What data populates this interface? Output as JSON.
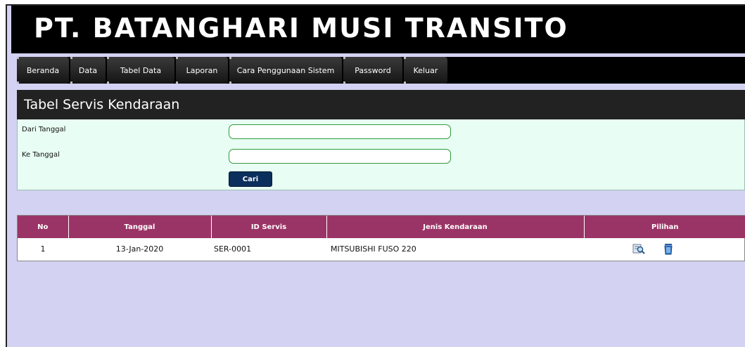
{
  "app": {
    "title": "PT. BATANGHARI MUSI TRANSITO"
  },
  "nav": [
    {
      "label": "Beranda"
    },
    {
      "label": "Data"
    },
    {
      "label": "Tabel Data"
    },
    {
      "label": "Laporan"
    },
    {
      "label": "Cara Penggunaan Sistem"
    },
    {
      "label": "Password"
    },
    {
      "label": "Keluar"
    }
  ],
  "panel": {
    "title": "Tabel Servis Kendaraan"
  },
  "form": {
    "from_label": "Dari Tanggal",
    "from_value": "",
    "to_label": "Ke Tanggal",
    "to_value": "",
    "search_button": "Cari"
  },
  "table": {
    "headers": [
      "No",
      "Tanggal",
      "ID Servis",
      "Jenis Kendaraan",
      "Pilihan"
    ],
    "rows": [
      {
        "no": "1",
        "tanggal": "13-Jan-2020",
        "id_servis": "SER-0001",
        "jenis": "MITSUBISHI FUSO 220",
        "actions": [
          "view-icon",
          "trash-icon"
        ]
      }
    ]
  },
  "colors": {
    "header_bg": "#9b3466",
    "page_bg": "#d3d2f2",
    "form_bg": "#e8fdf3",
    "button_bg": "#0b2f5c"
  }
}
